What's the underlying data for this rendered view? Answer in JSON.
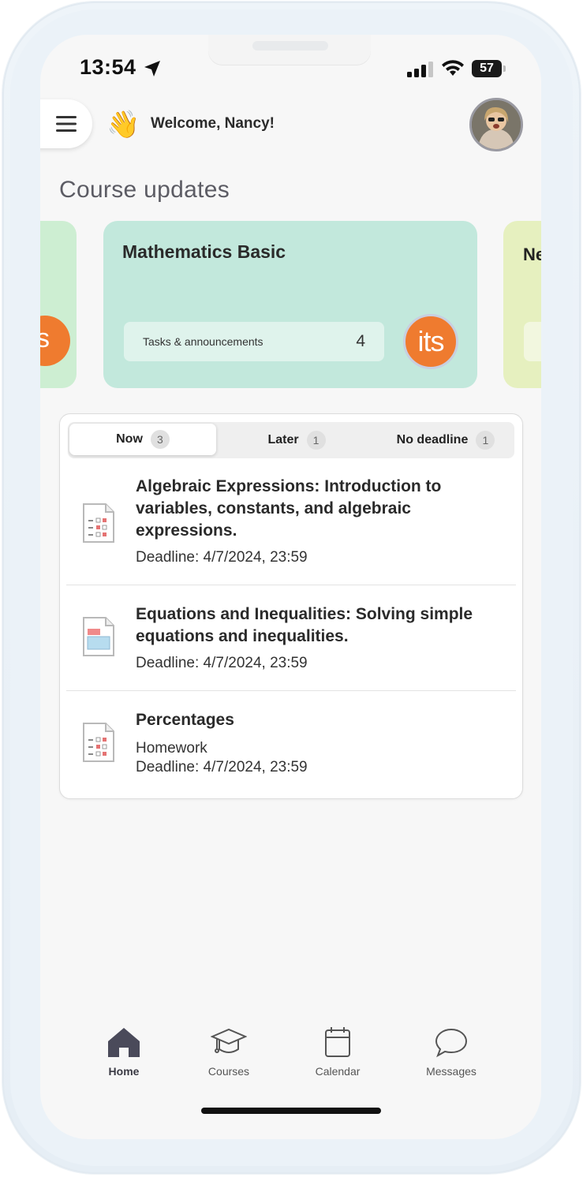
{
  "status_bar": {
    "time": "13:54",
    "battery": "57"
  },
  "header": {
    "welcome": "Welcome, Nancy!",
    "wave_emoji": "👋"
  },
  "section_title": "Course updates",
  "courses": {
    "left_logo": "its",
    "main": {
      "title": "Mathematics Basic",
      "tasks_label": "Tasks & announcements",
      "tasks_count": "4",
      "logo": "its"
    },
    "right_peek": "Ne"
  },
  "tabs": [
    {
      "label": "Now",
      "count": "3"
    },
    {
      "label": "Later",
      "count": "1"
    },
    {
      "label": "No deadline",
      "count": "1"
    }
  ],
  "tasks": [
    {
      "title": "Algebraic Expressions: Introduction to variables, constants, and algebraic expressions.",
      "type": "",
      "deadline": "Deadline: 4/7/2024, 23:59",
      "icon": "quiz-doc-icon"
    },
    {
      "title": "Equations and Inequalities: Solving simple equations and inequalities.",
      "type": "",
      "deadline": "Deadline: 4/7/2024, 23:59",
      "icon": "presentation-doc-icon"
    },
    {
      "title": "Percentages",
      "type": "Homework",
      "deadline": "Deadline: 4/7/2024, 23:59",
      "icon": "quiz-doc-icon"
    }
  ],
  "nav": [
    {
      "label": "Home",
      "icon": "home-icon",
      "active": true
    },
    {
      "label": "Courses",
      "icon": "graduation-cap-icon",
      "active": false
    },
    {
      "label": "Calendar",
      "icon": "calendar-icon",
      "active": false
    },
    {
      "label": "Messages",
      "icon": "chat-bubble-icon",
      "active": false
    }
  ],
  "colors": {
    "card_main": "#c2e8dc",
    "card_left": "#cdeed2",
    "card_right": "#e6f0bf",
    "logo_orange": "#ef7b2f",
    "nav_active": "#3a3a44"
  }
}
